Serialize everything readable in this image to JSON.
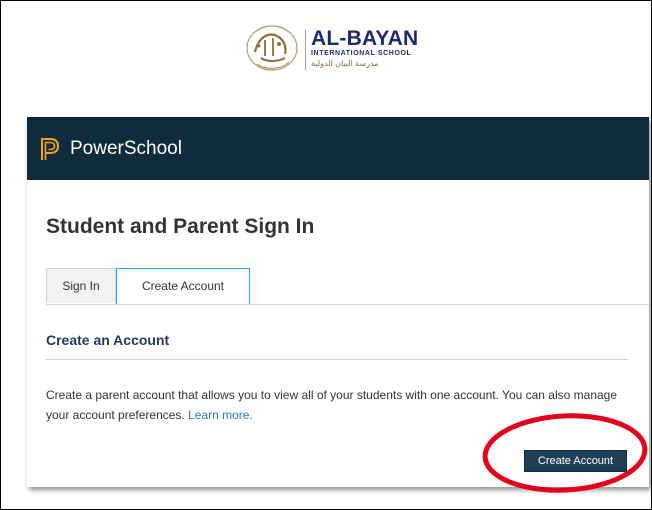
{
  "school": {
    "name": "AL-BAYAN",
    "subtitle": "INTERNATIONAL SCHOOL",
    "arabic_name": "مدرسة البيان الدولية",
    "emblem_icon": "al-bayan-calligraphy-emblem"
  },
  "powerschool": {
    "brand": "PowerSchool",
    "logo_icon": "powerschool-p-logo",
    "header_color": "#0f2b3c"
  },
  "page": {
    "title": "Student and Parent Sign In"
  },
  "tabs": [
    {
      "label": "Sign In",
      "active": false
    },
    {
      "label": "Create Account",
      "active": true
    }
  ],
  "section": {
    "title": "Create an Account",
    "description": "Create a parent account that allows you to view all of your students with one account. You can also manage your account preferences.",
    "learn_more": "Learn more."
  },
  "actions": {
    "create_account": "Create Account"
  },
  "colors": {
    "accent_blue": "#29a3d8",
    "link": "#2a79b9",
    "button": "#1f3f57",
    "highlight": "#e3001b"
  }
}
